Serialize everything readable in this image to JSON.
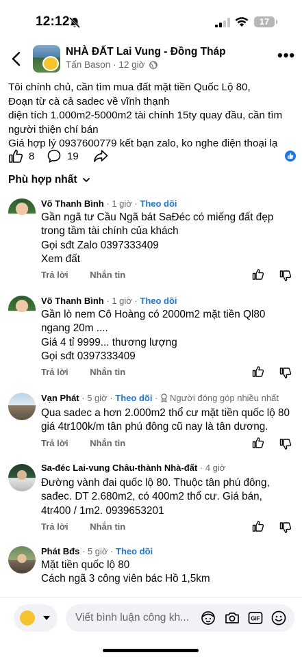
{
  "status_bar": {
    "time": "12:12",
    "battery": "17"
  },
  "header": {
    "group_name": "NHÀ ĐẤT Lai Vung - Đồng Tháp",
    "author": "Tấn Bason",
    "time": "12 giờ",
    "more": "•••"
  },
  "post": {
    "lines": [
      "Tôi chính chủ, cần tìm mua đất mặt tiền Quốc Lộ 80,",
      "Đoạn từ cà cả sadec về vĩnh thạnh",
      "diện tích 1.000m2-5000m2 tài chính 15ty quay đầu, cần tìm",
      "người thiện chí bán",
      "Giá hợp lý 0937600779 kết bạn zalo, ko nghe điện thoại lạ"
    ],
    "likes": "8",
    "comments": "19"
  },
  "sort_label": "Phù hợp nhất",
  "comments": [
    {
      "name": "Võ Thanh Bình",
      "time": "1 giờ",
      "follow": "Theo dõi",
      "lines": [
        "Gần ngã tư Cầu Ngã bát SaĐéc có miếng đất đẹp",
        "trong tầm tài chính của khách",
        "Gọi sđt Zalo 0397333409",
        "Xem đất"
      ],
      "reply": "Trả lời",
      "message": "Nhắn tin"
    },
    {
      "name": "Võ Thanh Bình",
      "time": "1 giờ",
      "follow": "Theo dõi",
      "lines": [
        "Gần lò nem Cô Hoàng có 2000m2 mặt tiền Ql80",
        "ngang 20m ....",
        "Giá 4 tỉ 9999... thương lượng",
        "Gọi sđt 0397333409"
      ],
      "reply": "Trả lời",
      "message": "Nhắn tin"
    },
    {
      "name": "Vạn Phát",
      "time": "5 giờ",
      "follow": "Theo dõi",
      "badge": "Người đóng góp nhiều nhất",
      "lines": [
        "Qua sadec a hơn 2.000m2 thổ cư mặt tiền quốc lộ 80",
        "giá 4tr100k/m tân phú đông cũ nay là tân dương."
      ],
      "reply": "Trả lời",
      "message": "Nhắn tin"
    },
    {
      "name": "Sa-đéc Lai-vung Châu-thành Nhà-đất",
      "time": "4 giờ",
      "lines": [
        "Đường vành đai quốc lộ 80. Thuộc tân phú đông,",
        "sađec. DT 2.680m2, có 400m2 thổ cư. Giá bán,",
        "4tr400 / 1m2. 0939653201"
      ],
      "reply": "Trả lời",
      "message": "Nhắn tin"
    },
    {
      "name": "Phát Bđs",
      "time": "5 giờ",
      "follow": "Theo dõi",
      "lines": [
        "Mặt tiền quốc lộ 80",
        "Cách ngã 3 công viên bác Hồ 1,5km"
      ]
    }
  ],
  "composer": {
    "placeholder": "Viết bình luận công kh..."
  },
  "colors": {
    "link": "#1877f2",
    "secondary_text": "#65676b",
    "input_bg": "#f0f2f5"
  }
}
